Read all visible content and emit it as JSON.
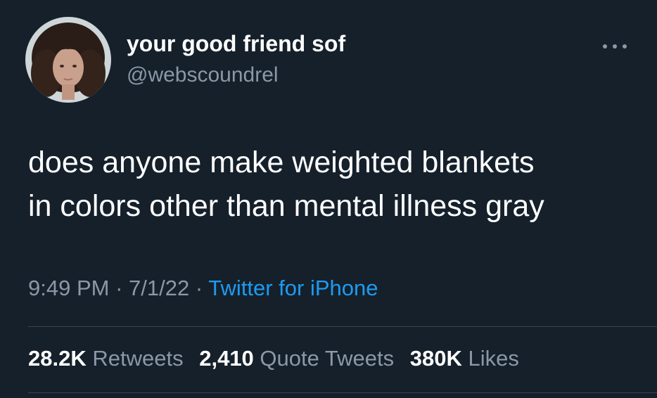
{
  "user": {
    "display_name": "your good friend sof",
    "handle": "@webscoundrel"
  },
  "tweet": {
    "lines": [
      "does anyone make weighted blankets",
      "in colors other than mental illness gray"
    ]
  },
  "meta": {
    "time": "9:49 PM",
    "separator": "·",
    "date": "7/1/22",
    "source": "Twitter for iPhone"
  },
  "stats": {
    "retweets": {
      "count": "28.2K",
      "label": "Retweets"
    },
    "quote_tweets": {
      "count": "2,410",
      "label": "Quote Tweets"
    },
    "likes": {
      "count": "380K",
      "label": "Likes"
    }
  },
  "colors": {
    "background": "#15202b",
    "primary_text": "#ffffff",
    "secondary_text": "#8b98a5",
    "link": "#1d9bf0",
    "divider": "#38444d"
  },
  "icons": {
    "more": "more-horizontal-icon"
  }
}
